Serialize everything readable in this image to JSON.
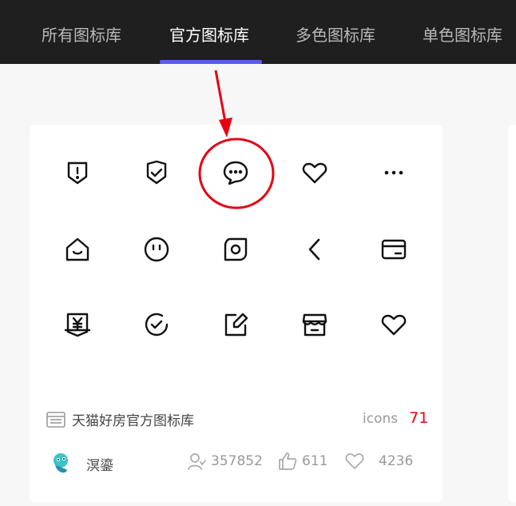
{
  "nav": {
    "tabs": [
      {
        "label": "所有图标库"
      },
      {
        "label": "官方图标库"
      },
      {
        "label": "多色图标库"
      },
      {
        "label": "单色图标库"
      }
    ]
  },
  "card": {
    "icons": [
      [
        "shield-alert-icon",
        "shield-check-icon",
        "chat-bubble-icon",
        "heart-icon",
        "more-dots-icon"
      ],
      [
        "home-smile-icon",
        "face-neutral-icon",
        "camera-square-icon",
        "chevron-left-icon",
        "card-icon"
      ],
      [
        "yuan-bill-icon",
        "check-circle-icon",
        "edit-icon",
        "store-icon",
        "heart-outline-icon"
      ]
    ],
    "library_name": "天猫好房官方图标库",
    "icons_label": "icons",
    "icon_count": "71",
    "author": "溟鎏",
    "stats": {
      "users": "357852",
      "likes": "611",
      "favorites": "4236"
    }
  },
  "colors": {
    "nav_bg": "#1f1f1f",
    "accent": "#5b5bf0",
    "count_red": "#e60012",
    "annotation_red": "#e60012"
  }
}
